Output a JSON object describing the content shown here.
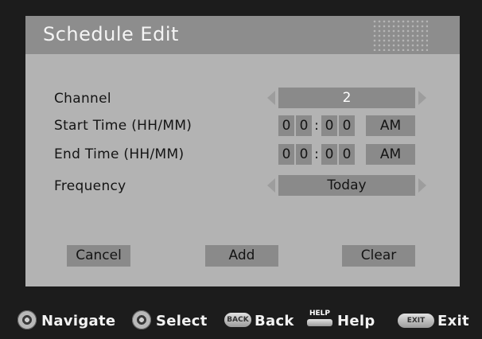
{
  "dialog": {
    "title": "Schedule Edit",
    "fields": {
      "channel": {
        "label": "Channel",
        "value": "2"
      },
      "start_time": {
        "label": "Start Time (HH/MM)",
        "digits": [
          "0",
          "0",
          "0",
          "0"
        ],
        "separator": ":",
        "period": "AM"
      },
      "end_time": {
        "label": "End Time (HH/MM)",
        "digits": [
          "0",
          "0",
          "0",
          "0"
        ],
        "separator": ":",
        "period": "AM"
      },
      "frequency": {
        "label": "Frequency",
        "value": "Today"
      }
    },
    "buttons": {
      "cancel": "Cancel",
      "add": "Add",
      "clear": "Clear"
    }
  },
  "footer": {
    "navigate": {
      "icon": "dpad-navigate-icon",
      "label": "Navigate"
    },
    "select": {
      "icon": "dpad-select-icon",
      "label": "Select"
    },
    "back": {
      "icon": "back-button-icon",
      "icon_text": "BACK",
      "label": "Back"
    },
    "help": {
      "icon": "help-button-icon",
      "icon_text": "HELP",
      "label": "Help"
    },
    "exit": {
      "icon": "exit-button-icon",
      "icon_text": "EXIT",
      "label": "Exit"
    }
  },
  "colors": {
    "screen_background": "#1c1c1c",
    "dialog_background": "#b3b3b3",
    "title_bar": "#8d8d8d",
    "field_background": "#8a8a8a"
  }
}
